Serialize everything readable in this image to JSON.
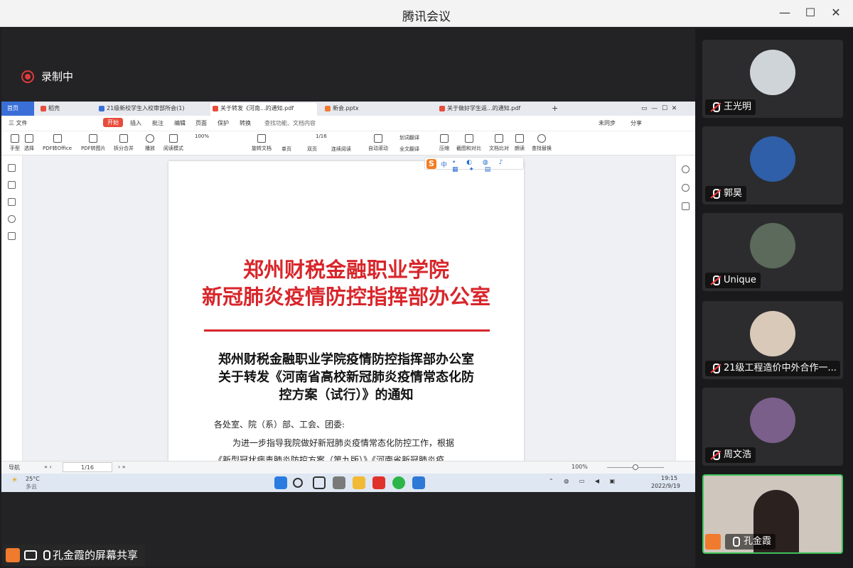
{
  "window": {
    "title": "腾讯会议"
  },
  "recording": {
    "label": "录制中"
  },
  "browser_tabs": [
    {
      "label": "首页"
    },
    {
      "label": "稻壳"
    },
    {
      "label": "21级新校学生入校审部所会(1)"
    },
    {
      "label": "关于转发《河南...的通知.pdf"
    },
    {
      "label": "新会.pptx"
    },
    {
      "label": "关于做好学生返...的通知.pdf"
    }
  ],
  "menu": [
    "三 文件",
    "开始",
    "插入",
    "批注",
    "编辑",
    "页面",
    "保护",
    "转换",
    "查找功能、文档内容"
  ],
  "menu_right": [
    "未同步",
    "分享"
  ],
  "ribbon": [
    "手型",
    "选择",
    "PDF转Office",
    "PDF转图片",
    "拆分合并",
    "播放",
    "阅读模式",
    "旋转文档",
    "单页",
    "双页",
    "连续阅读",
    "自动滚动",
    "划词翻译",
    "全文翻译",
    "压缩",
    "截图和对比",
    "文档比对",
    "朗读",
    "查找替换"
  ],
  "zoom_top": "100%",
  "page_top": "1/16",
  "doc": {
    "org_line1": "郑州财税金融职业学院",
    "org_line2": "新冠肺炎疫情防控指挥部办公室",
    "heading1": "郑州财税金融职业学院疫情防控指挥部办公室",
    "heading2": "关于转发《河南省高校新冠肺炎疫情常态化防",
    "heading3": "控方案（试行）》的通知",
    "recipient": "各处室、院（系）部、工会、团委:",
    "para1": "为进一步指导我院做好新冠肺炎疫情常态化防控工作，根据",
    "para2": "《新型冠状病毒肺炎防控方案（第九版）》《河南省新冠肺炎疫"
  },
  "ime": {
    "logo": "S",
    "lang": "中"
  },
  "status": {
    "nav": "导航",
    "page": "1/16",
    "zoom": "100%"
  },
  "taskbar": {
    "weather_temp": "25°C",
    "weather_desc": "多云",
    "time": "19:15",
    "date": "2022/9/19"
  },
  "participants": [
    {
      "name": "王光明",
      "muted": true,
      "color": "#cfd4d8"
    },
    {
      "name": "郭昊",
      "muted": true,
      "color": "#2e5fa8"
    },
    {
      "name": "Unique",
      "muted": true,
      "color": "#5b6a5a"
    },
    {
      "name": "21级工程造价中外合作一...",
      "muted": true,
      "color": "#d9c9b8"
    },
    {
      "name": "周文浩",
      "muted": true,
      "color": "#7a5f8a"
    },
    {
      "name": "孔金霞",
      "muted": false,
      "color": "#b9a79a"
    }
  ],
  "share": {
    "label": "孔金霞的屏幕共享"
  }
}
